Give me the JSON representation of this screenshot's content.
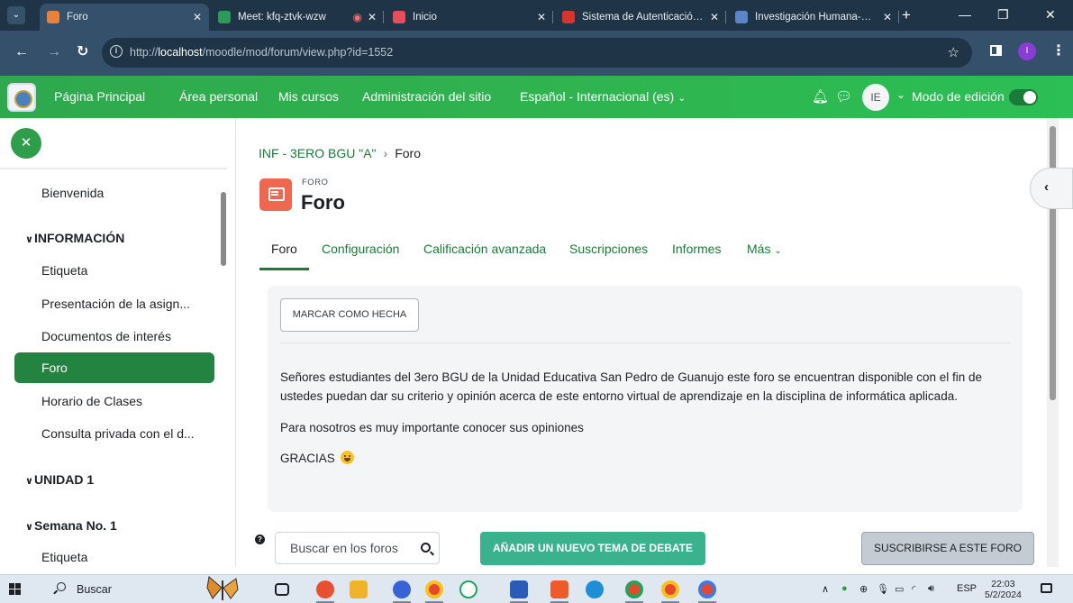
{
  "browser": {
    "tabs": [
      {
        "title": "Foro",
        "active": true,
        "icon": "moodle-favicon"
      },
      {
        "title": "Meet: kfq-ztvk-wzw",
        "active": false,
        "icon": "meet-icon",
        "recording": true
      },
      {
        "title": "Inicio",
        "active": false,
        "icon": "moodle-favicon"
      },
      {
        "title": "Sistema de Autenticación Ce",
        "active": false,
        "icon": "auth-favicon"
      },
      {
        "title": "Investigación Humana-Cultu",
        "active": false,
        "icon": "research-favicon"
      }
    ],
    "url_prefix": "http://",
    "url_host": "localhost",
    "url_path": "/moodle/mod/forum/view.php?id=1552",
    "profile_initial": "I"
  },
  "navbar": {
    "links": [
      "Página Principal",
      "Área personal",
      "Mis cursos",
      "Administración del sitio"
    ],
    "language": "Español - Internacional (es)",
    "user_initials": "IE",
    "edit_mode_label": "Modo de edición",
    "edit_mode_on": true
  },
  "drawer": {
    "items": [
      {
        "type": "item",
        "label": "Bienvenida"
      },
      {
        "type": "section",
        "label": "INFORMACIÓN"
      },
      {
        "type": "item",
        "label": "Etiqueta"
      },
      {
        "type": "item",
        "label": "Presentación de la asign..."
      },
      {
        "type": "item",
        "label": "Documentos de interés"
      },
      {
        "type": "item",
        "label": "Foro",
        "active": true
      },
      {
        "type": "item",
        "label": "Horario de Clases"
      },
      {
        "type": "item",
        "label": "Consulta privada con el d..."
      },
      {
        "type": "section",
        "label": "UNIDAD 1"
      },
      {
        "type": "section",
        "label": "Semana No. 1"
      },
      {
        "type": "item",
        "label": "Etiqueta"
      }
    ]
  },
  "main": {
    "breadcrumb": [
      "INF - 3ERO BGU \"A\"",
      "Foro"
    ],
    "module_kind": "FORO",
    "title": "Foro",
    "tabs": [
      "Foro",
      "Configuración",
      "Calificación avanzada",
      "Suscripciones",
      "Informes",
      "Más"
    ],
    "active_tab": "Foro",
    "mark_done_label": "MARCAR COMO HECHA",
    "description": [
      "Señores estudiantes del 3ero BGU de la Unidad Educativa San Pedro de Guanujo este foro se encuentran disponible con el fin de ustedes puedan dar su criterio y opinión acerca de este entorno virtual de aprendizaje en la disciplina de informática aplicada.",
      "Para nosotros es muy importante conocer sus opiniones",
      "GRACIAS"
    ],
    "search_placeholder": "Buscar en los foros",
    "add_topic_label": "AÑADIR UN NUEVO TEMA DE DEBATE",
    "subscribe_label": "SUSCRIBIRSE A ESTE FORO"
  },
  "taskbar": {
    "search_label": "Buscar",
    "language": "ESP",
    "time": "22:03",
    "date": "5/2/2024"
  },
  "colors": {
    "navbar_green": "#2fb34f",
    "active_item": "#238442",
    "link_green": "#1a7a38",
    "forum_icon": "#f0674f",
    "add_button": "#3bb28e"
  }
}
